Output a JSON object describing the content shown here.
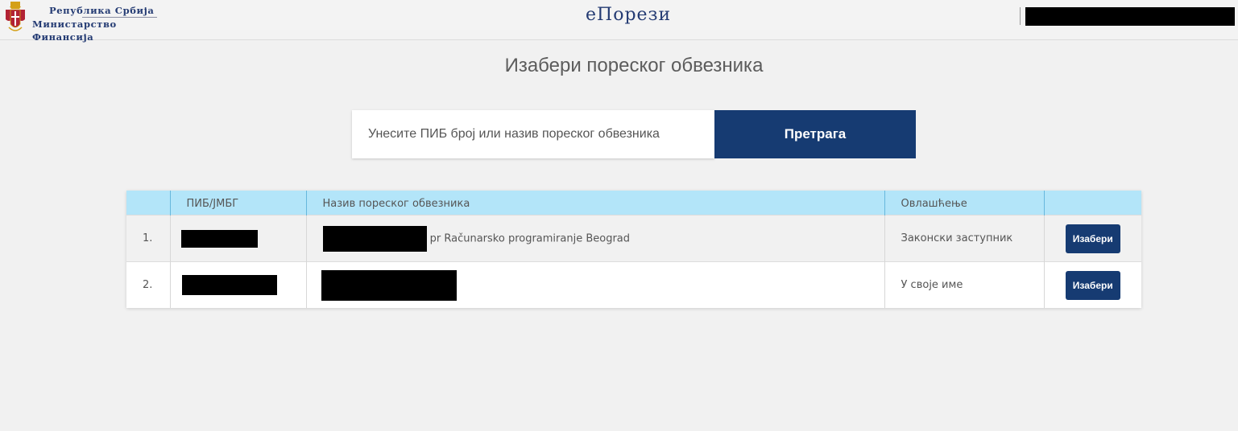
{
  "header": {
    "ministry_line1": "Република Србија",
    "ministry_line2": "Министарство Финансија",
    "brand": "еПорези",
    "colors": {
      "brand": "#243b73",
      "primary": "#163b72",
      "table_header": "#b3e5f9"
    }
  },
  "main": {
    "title": "Изабери пореског обвезника",
    "search": {
      "placeholder": "Унесите ПИБ број или назив пореског обвезника",
      "button_label": "Претрага"
    },
    "table": {
      "columns": [
        "",
        "ПИБ/ЈМБГ",
        "Назив пореског обвезника",
        "Овлашћење",
        ""
      ],
      "rows": [
        {
          "index": "1.",
          "name_suffix": "pr Računarsko programiranje Beograd",
          "authorization": "Законски заступник",
          "action": "Изабери"
        },
        {
          "index": "2.",
          "name_suffix": "",
          "authorization": "У своје име",
          "action": "Изабери"
        }
      ]
    }
  }
}
